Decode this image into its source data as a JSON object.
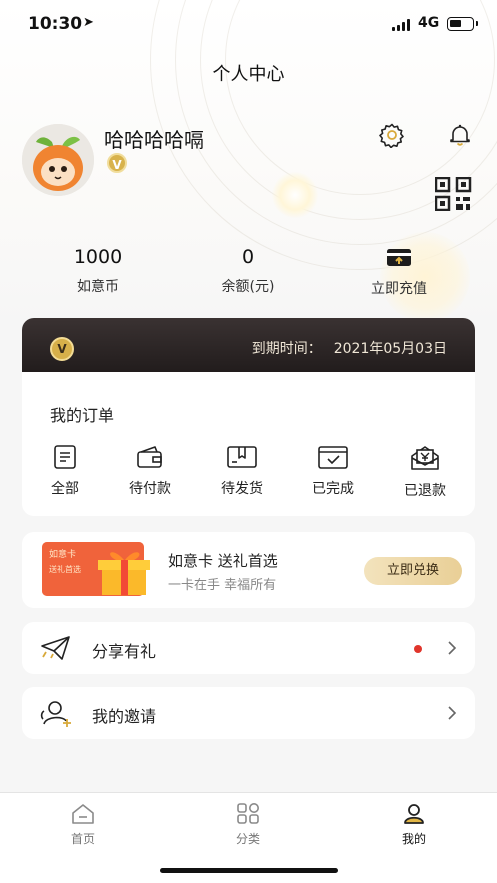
{
  "status_bar": {
    "time": "10:30",
    "location_glyph": "➤",
    "network": "4G"
  },
  "header": {
    "title": "个人中心"
  },
  "profile": {
    "username": "哈哈哈哈嗝",
    "vip_badge": "V",
    "icons": [
      "settings-icon",
      "bell-icon",
      "qr-code-icon"
    ]
  },
  "stats": [
    {
      "value": "1000",
      "label": "如意币"
    },
    {
      "value": "0",
      "label": "余额(元)"
    },
    {
      "value": "",
      "label": "立即充值"
    }
  ],
  "vip": {
    "badge": "V",
    "expiry_label": "到期时间：",
    "expiry_date": "2021年05月03日"
  },
  "orders": {
    "title": "我的订单",
    "items": [
      {
        "label": "全部",
        "icon": "list-icon"
      },
      {
        "label": "待付款",
        "icon": "wallet-icon"
      },
      {
        "label": "待发货",
        "icon": "package-icon"
      },
      {
        "label": "已完成",
        "icon": "completed-box-icon"
      },
      {
        "label": "已退款",
        "icon": "refund-icon"
      }
    ]
  },
  "promo": {
    "card_title": "如意卡",
    "card_subtitle": "送礼首选",
    "title": "如意卡 送礼首选",
    "subtitle": "一卡在手 幸福所有",
    "button": "立即兑换"
  },
  "menu": [
    {
      "label": "分享有礼",
      "icon": "paper-plane-icon",
      "has_dot": true
    },
    {
      "label": "我的邀请",
      "icon": "add-user-icon",
      "has_dot": false
    }
  ],
  "tabbar": {
    "active": "我的",
    "items": [
      {
        "label": "首页",
        "icon": "home-icon"
      },
      {
        "label": "分类",
        "icon": "grid-icon"
      },
      {
        "label": "我的",
        "icon": "user-icon"
      }
    ]
  },
  "colors": {
    "accent_gold": "#d8b24c",
    "vip_dark": "#2a2323",
    "dot_red": "#e0352b"
  }
}
